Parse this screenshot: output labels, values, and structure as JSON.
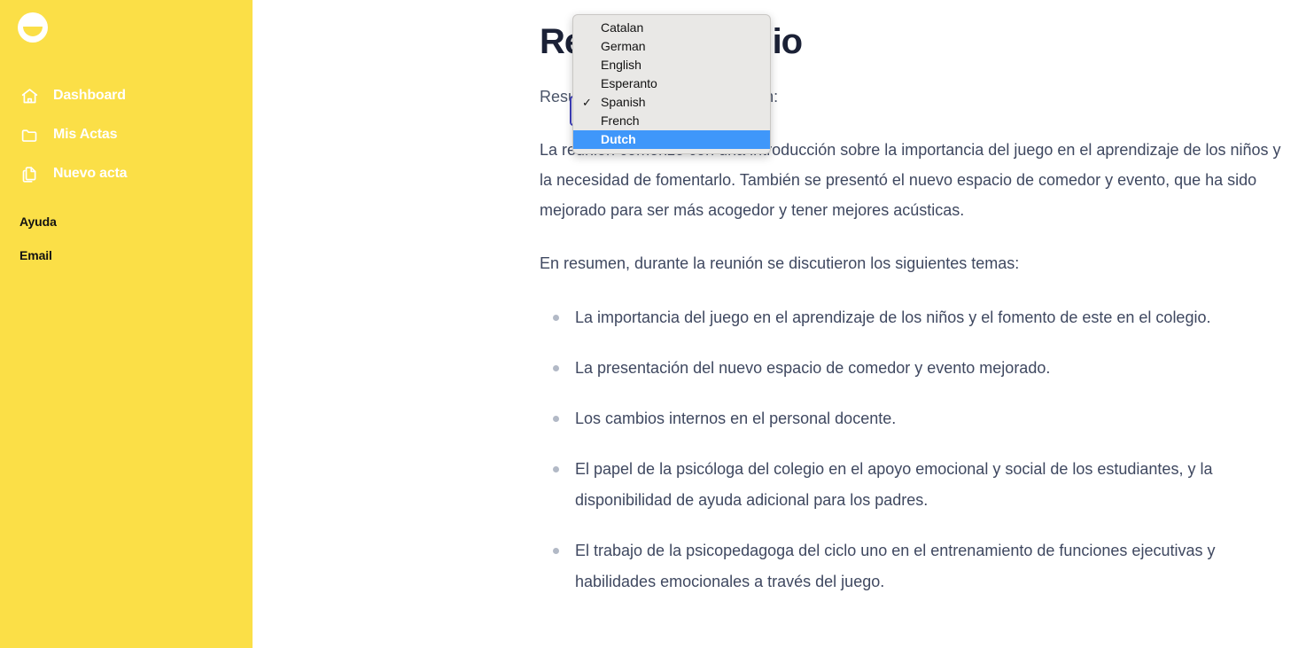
{
  "sidebar": {
    "logo": {
      "icon": "half-disc-logo-icon"
    },
    "nav_items": [
      {
        "label": "Dashboard",
        "icon": "home-icon"
      },
      {
        "label": "Mis Actas",
        "icon": "folder-icon"
      },
      {
        "label": "Nuevo acta",
        "icon": "documents-icon"
      }
    ],
    "links": [
      {
        "label": "Ayuda"
      },
      {
        "label": "Email"
      }
    ],
    "background_color": "#FBDF47",
    "label_color": "#FFFFFF",
    "link_color": "#121212"
  },
  "language_select": {
    "value": "Spanish",
    "focus_border_color": "#3F3FBE",
    "expanded": true,
    "options": [
      {
        "label": "Catalan",
        "checked": false,
        "highlighted": false
      },
      {
        "label": "German",
        "checked": false,
        "highlighted": false
      },
      {
        "label": "English",
        "checked": false,
        "highlighted": false
      },
      {
        "label": "Esperanto",
        "checked": false,
        "highlighted": false
      },
      {
        "label": "Spanish",
        "checked": true,
        "highlighted": false
      },
      {
        "label": "French",
        "checked": false,
        "highlighted": false
      },
      {
        "label": "Dutch",
        "checked": false,
        "highlighted": true
      }
    ],
    "popup_background_color": "#E9E8E6",
    "highlight_color": "#3F97FA"
  },
  "main": {
    "title": "Reunión colegio",
    "lead": "Resumen detallado de la reunión:",
    "paragraph_1": "La reunión comenzó con una introducción sobre la importancia del juego en el aprendizaje de los niños y la necesidad de fomentarlo. También se presentó el nuevo espacio de comedor y evento, que ha sido mejorado para ser más acogedor y tener mejores acústicas.",
    "paragraph_2": "En resumen, durante la reunión se discutieron los siguientes temas:",
    "bullets": [
      "La importancia del juego en el aprendizaje de los niños y el fomento de este en el colegio.",
      "La presentación del nuevo espacio de comedor y evento mejorado.",
      "Los cambios internos en el personal docente.",
      "El papel de la psicóloga del colegio en el apoyo emocional y social de los estudiantes, y la disponibilidad de ayuda adicional para los padres.",
      "El trabajo de la psicopedagoga del ciclo uno en el entrenamiento de funciones ejecutivas y habilidades emocionales a través del juego."
    ],
    "title_color": "#1B2136",
    "text_color": "#3F4860",
    "bullet_color": "#B2B9C6"
  }
}
